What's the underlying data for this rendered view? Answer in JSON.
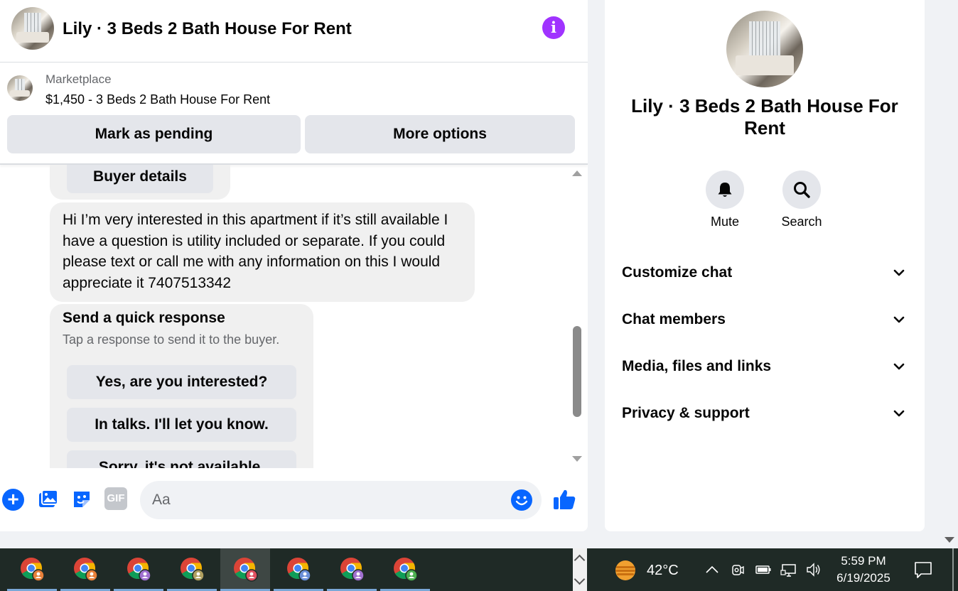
{
  "header": {
    "title": "Lily · 3 Beds 2 Bath House For Rent",
    "info_icon": "info-icon",
    "accent_color": "#a033ff"
  },
  "listing": {
    "source": "Marketplace",
    "title": "$1,450 - 3 Beds 2 Bath House For Rent",
    "pending_label": "Mark as pending",
    "more_label": "More options"
  },
  "messages": {
    "buyer_details_label": "Buyer details",
    "buyer_message": "Hi I’m very interested in this apartment if it’s still available I have a question is utility included or separate. If you could please text or call me with any information on this I would appreciate it 7407513342",
    "quick_response": {
      "title": "Send a quick response",
      "subtitle": "Tap a response to send it to the buyer.",
      "options": [
        "Yes, are you interested?",
        "In talks. I'll let you know.",
        "Sorry, it's not available."
      ]
    }
  },
  "composer": {
    "placeholder": "Aa",
    "tools": [
      "plus-icon",
      "photo-icon",
      "sticker-icon",
      "gif-icon"
    ],
    "gif_label": "GIF",
    "brand_color": "#0866ff"
  },
  "details": {
    "title": "Lily · 3 Beds 2 Bath House For Rent",
    "actions": [
      {
        "label": "Mute",
        "icon": "bell-icon"
      },
      {
        "label": "Search",
        "icon": "search-icon"
      }
    ],
    "sections": [
      "Customize chat",
      "Chat members",
      "Media, files and links",
      "Privacy & support"
    ]
  },
  "taskbar": {
    "apps": [
      {
        "name": "chrome-profile-1",
        "badge_color": "#e8803a"
      },
      {
        "name": "chrome-profile-2",
        "badge_color": "#e8803a"
      },
      {
        "name": "chrome-profile-3",
        "badge_color": "#a070d0"
      },
      {
        "name": "chrome-profile-4",
        "badge_color": "#b0a060"
      },
      {
        "name": "chrome-profile-5",
        "badge_color": "#e05060"
      },
      {
        "name": "chrome-profile-6",
        "badge_color": "#6a8fd8"
      },
      {
        "name": "chrome-profile-7",
        "badge_color": "#a070d0"
      },
      {
        "name": "chrome-profile-8",
        "badge_color": "#4caf50"
      }
    ],
    "active_app_index": 4,
    "temperature": "42°C",
    "time": "5:59 PM",
    "date": "6/19/2025"
  }
}
